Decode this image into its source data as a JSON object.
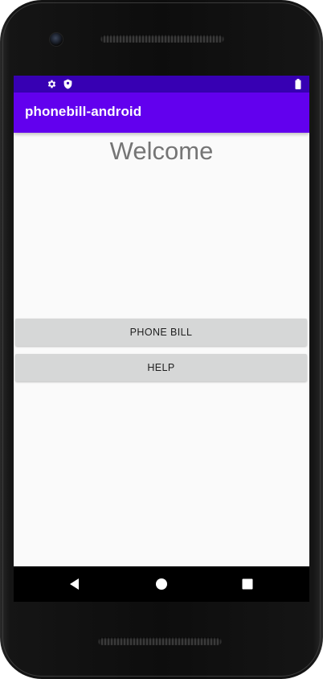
{
  "app": {
    "title": "phonebill-android"
  },
  "statusbar": {
    "icons": [
      "settings-icon",
      "shield-icon",
      "battery-icon"
    ]
  },
  "main": {
    "welcome_text": "Welcome",
    "buttons": {
      "phone_bill_label": "PHONE BILL",
      "help_label": "HELP"
    }
  },
  "navbar": {
    "icons": [
      "back-icon",
      "home-icon",
      "recents-icon"
    ]
  },
  "colors": {
    "status_bar": "#3700b3",
    "app_bar": "#6200ee",
    "button_bg": "#d6d7d7",
    "screen_bg": "#fafafa"
  }
}
